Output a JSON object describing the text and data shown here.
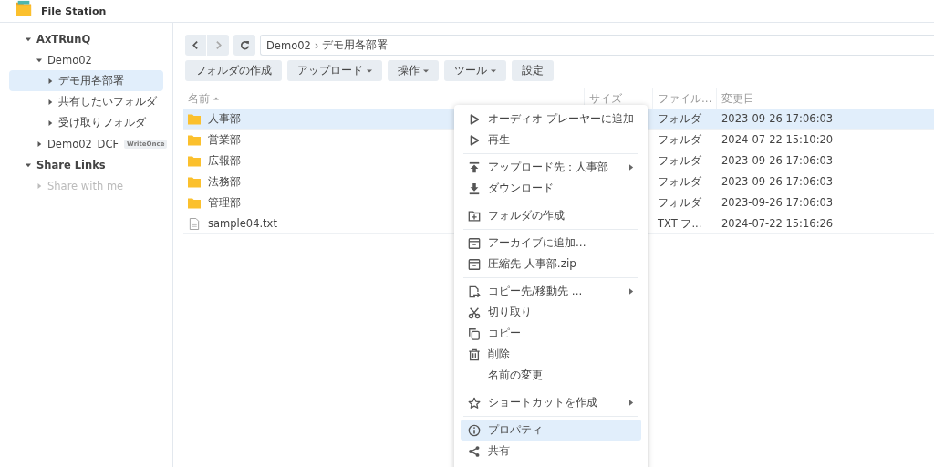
{
  "app": {
    "title": "File Station"
  },
  "sidebar": {
    "tree": [
      {
        "label": "AxTRunQ",
        "expanded": true,
        "selected": false,
        "disabled": false,
        "children": [
          {
            "label": "Demo02",
            "expanded": true,
            "selected": false,
            "disabled": false,
            "children": [
              {
                "label": "デモ用各部署",
                "expanded": false,
                "selected": true,
                "disabled": false
              },
              {
                "label": "共有したいフォルダ",
                "expanded": false,
                "selected": false,
                "disabled": false
              },
              {
                "label": "受け取りフォルダ",
                "expanded": false,
                "selected": false,
                "disabled": false
              }
            ]
          },
          {
            "label": "Demo02_DCF",
            "expanded": false,
            "selected": false,
            "disabled": false,
            "badge": "WriteOnce"
          }
        ]
      },
      {
        "label": "Share Links",
        "expanded": true,
        "selected": false,
        "disabled": false,
        "children": [
          {
            "label": "Share with me",
            "expanded": false,
            "selected": false,
            "disabled": true
          }
        ]
      }
    ]
  },
  "path": {
    "segments": [
      "Demo02",
      "デモ用各部署"
    ],
    "separator": "›"
  },
  "toolbar": [
    {
      "label": "フォルダの作成",
      "dropdown": false
    },
    {
      "label": "アップロード",
      "dropdown": true
    },
    {
      "label": "操作",
      "dropdown": true
    },
    {
      "label": "ツール",
      "dropdown": true
    },
    {
      "label": "設定",
      "dropdown": false
    }
  ],
  "table": {
    "columns": [
      {
        "label": "名前",
        "sorted": true
      },
      {
        "label": "サイズ",
        "sorted": false
      },
      {
        "label": "ファイル...",
        "sorted": false
      },
      {
        "label": "変更日",
        "sorted": false
      }
    ],
    "rows": [
      {
        "name": "人事部",
        "kind": "folder",
        "type": "フォルダ",
        "modified": "2023-09-26 17:06:03",
        "selected": true
      },
      {
        "name": "営業部",
        "kind": "folder",
        "type": "フォルダ",
        "modified": "2024-07-22 15:10:20",
        "selected": false
      },
      {
        "name": "広報部",
        "kind": "folder",
        "type": "フォルダ",
        "modified": "2023-09-26 17:06:03",
        "selected": false
      },
      {
        "name": "法務部",
        "kind": "folder",
        "type": "フォルダ",
        "modified": "2023-09-26 17:06:03",
        "selected": false
      },
      {
        "name": "管理部",
        "kind": "folder",
        "type": "フォルダ",
        "modified": "2023-09-26 17:06:03",
        "selected": false
      },
      {
        "name": "sample04.txt",
        "kind": "file",
        "type": "TXT フ...",
        "modified": "2024-07-22 15:16:26",
        "selected": false
      }
    ]
  },
  "context_menu": {
    "groups": [
      [
        {
          "label": "オーディオ プレーヤーに追加",
          "kind": "play",
          "submenu": false,
          "selected": false
        },
        {
          "label": "再生",
          "kind": "play",
          "submenu": false,
          "selected": false
        }
      ],
      [
        {
          "label": "アップロード先：人事部",
          "kind": "upload",
          "submenu": true,
          "selected": false
        },
        {
          "label": "ダウンロード",
          "kind": "download",
          "submenu": false,
          "selected": false
        }
      ],
      [
        {
          "label": "フォルダの作成",
          "kind": "folder-plus",
          "submenu": false,
          "selected": false
        }
      ],
      [
        {
          "label": "アーカイブに追加...",
          "kind": "archive",
          "submenu": false,
          "selected": false
        },
        {
          "label": "圧縮先 人事部.zip",
          "kind": "archive",
          "submenu": false,
          "selected": false
        }
      ],
      [
        {
          "label": "コピー先/移動先 ...",
          "kind": "copy-move",
          "submenu": true,
          "selected": false
        },
        {
          "label": "切り取り",
          "kind": "scissors",
          "submenu": false,
          "selected": false
        },
        {
          "label": "コピー",
          "kind": "copy",
          "submenu": false,
          "selected": false
        },
        {
          "label": "削除",
          "kind": "trash",
          "submenu": false,
          "selected": false
        },
        {
          "label": "名前の変更",
          "kind": "plain",
          "submenu": false,
          "selected": false
        }
      ],
      [
        {
          "label": "ショートカットを作成",
          "kind": "star",
          "submenu": true,
          "selected": false
        }
      ],
      [
        {
          "label": "プロパティ",
          "kind": "info",
          "submenu": false,
          "selected": true
        },
        {
          "label": "共有",
          "kind": "share",
          "submenu": false,
          "selected": false
        }
      ]
    ]
  }
}
